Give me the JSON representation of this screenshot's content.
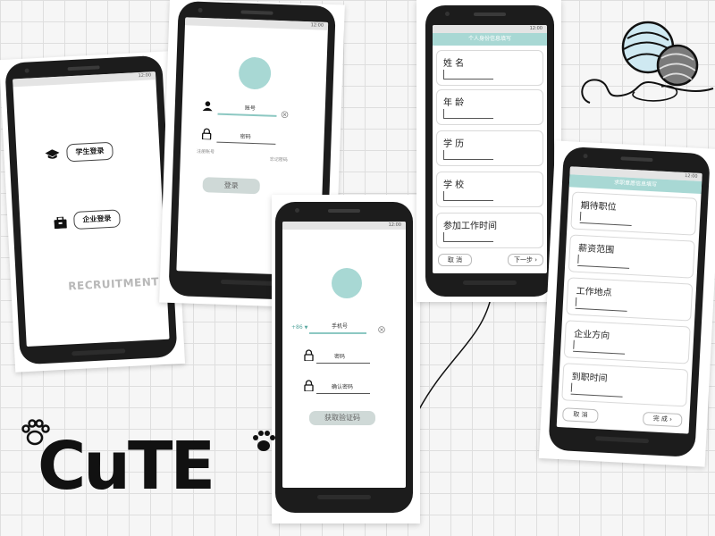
{
  "status_time": "12:00",
  "screen1": {
    "student_login": "学生登录",
    "company_login": "企业登录",
    "watermark": "RECRUITMENT"
  },
  "screen2": {
    "account_label": "账号",
    "password_label": "密码",
    "register": "注册账号",
    "forgot": "忘记密码",
    "login_button": "登录"
  },
  "screen3": {
    "country_code": "+86",
    "phone_label": "手机号",
    "password_label": "密码",
    "confirm_label": "确认密码",
    "verify_button": "获取验证码"
  },
  "screen4": {
    "title": "个人身份信息填写",
    "fields": [
      "姓 名",
      "年 龄",
      "学 历",
      "学 校",
      "参加工作时间"
    ],
    "cancel": "取 消",
    "next": "下一步"
  },
  "screen5": {
    "title": "求职意愿信息填写",
    "fields": [
      "期待职位",
      "薪资范围",
      "工作地点",
      "企业方向",
      "到职时间"
    ],
    "cancel": "取 消",
    "finish": "完 成"
  },
  "decor": {
    "cute_word": "CuTE"
  },
  "colors": {
    "accent": "#a8d8d4",
    "dark": "#1c1c1c"
  },
  "icons": [
    "graduation-cap-icon",
    "briefcase-icon",
    "user-icon",
    "lock-icon",
    "clear-icon",
    "dropdown-arrow-icon",
    "chevron-right-icon",
    "yarn-ball-icon",
    "paw-icon"
  ]
}
